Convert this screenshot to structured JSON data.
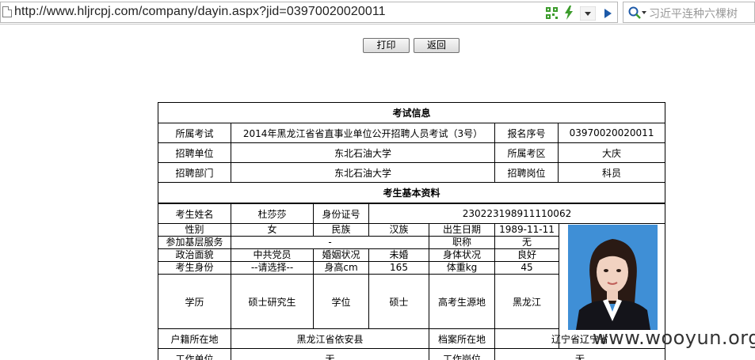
{
  "browser": {
    "url": "http://www.hljrcpj.com/company/dayin.aspx?jid=03970020020011",
    "search_placeholder": "习近平连种六棵树",
    "accent_green": "#3c9c2c",
    "accent_blue": "#1e5aa8"
  },
  "actions": {
    "print_label": "打印",
    "back_label": "返回"
  },
  "exam_info": {
    "section_title": "考试信息",
    "exam_label": "所属考试",
    "exam_value": "2014年黑龙江省省直事业单位公开招聘人员考试（3号）",
    "reg_no_label": "报名序号",
    "reg_no_value": "03970020020011",
    "employer_label": "招聘单位",
    "employer_value": "东北石油大学",
    "area_label": "所属考区",
    "area_value": "大庆",
    "dept_label": "招聘部门",
    "dept_value": "东北石油大学",
    "post_label": "招聘岗位",
    "post_value": "科员"
  },
  "candidate": {
    "section_title": "考生基本资料",
    "name_label": "考生姓名",
    "name_value": "杜莎莎",
    "id_label": "身份证号",
    "id_value": "230223198911110062",
    "gender_label": "性别",
    "gender_value": "女",
    "ethnicity_label": "民族",
    "ethnicity_value": "汉族",
    "birth_label": "出生日期",
    "birth_value": "1989-11-11",
    "grassroots_label": "参加基层服务",
    "grassroots_value": "-",
    "title_label": "职称",
    "title_value": "无",
    "politics_label": "政治面貌",
    "politics_value": "中共党员",
    "marital_label": "婚姻状况",
    "marital_value": "未婚",
    "health_label": "身体状况",
    "health_value": "良好",
    "identity_label": "考生身份",
    "identity_value": "--请选择--",
    "height_label": "身高cm",
    "height_value": "165",
    "weight_label": "体重kg",
    "weight_value": "45",
    "education_label": "学历",
    "education_value": "硕士研究生",
    "degree_label": "学位",
    "degree_value": "硕士",
    "origin_label": "高考生源地",
    "origin_value": "黑龙江",
    "hukou_label": "户籍所在地",
    "hukou_value": "黑龙江省依安县",
    "archive_label": "档案所在地",
    "archive_value": "辽宁省辽宁省",
    "workplace_label": "工作单位",
    "workplace_value": "无",
    "job_label": "工作岗位",
    "job_value": "无",
    "photo_bg": "#3f8fd6"
  },
  "watermark": "www.wooyun.org"
}
